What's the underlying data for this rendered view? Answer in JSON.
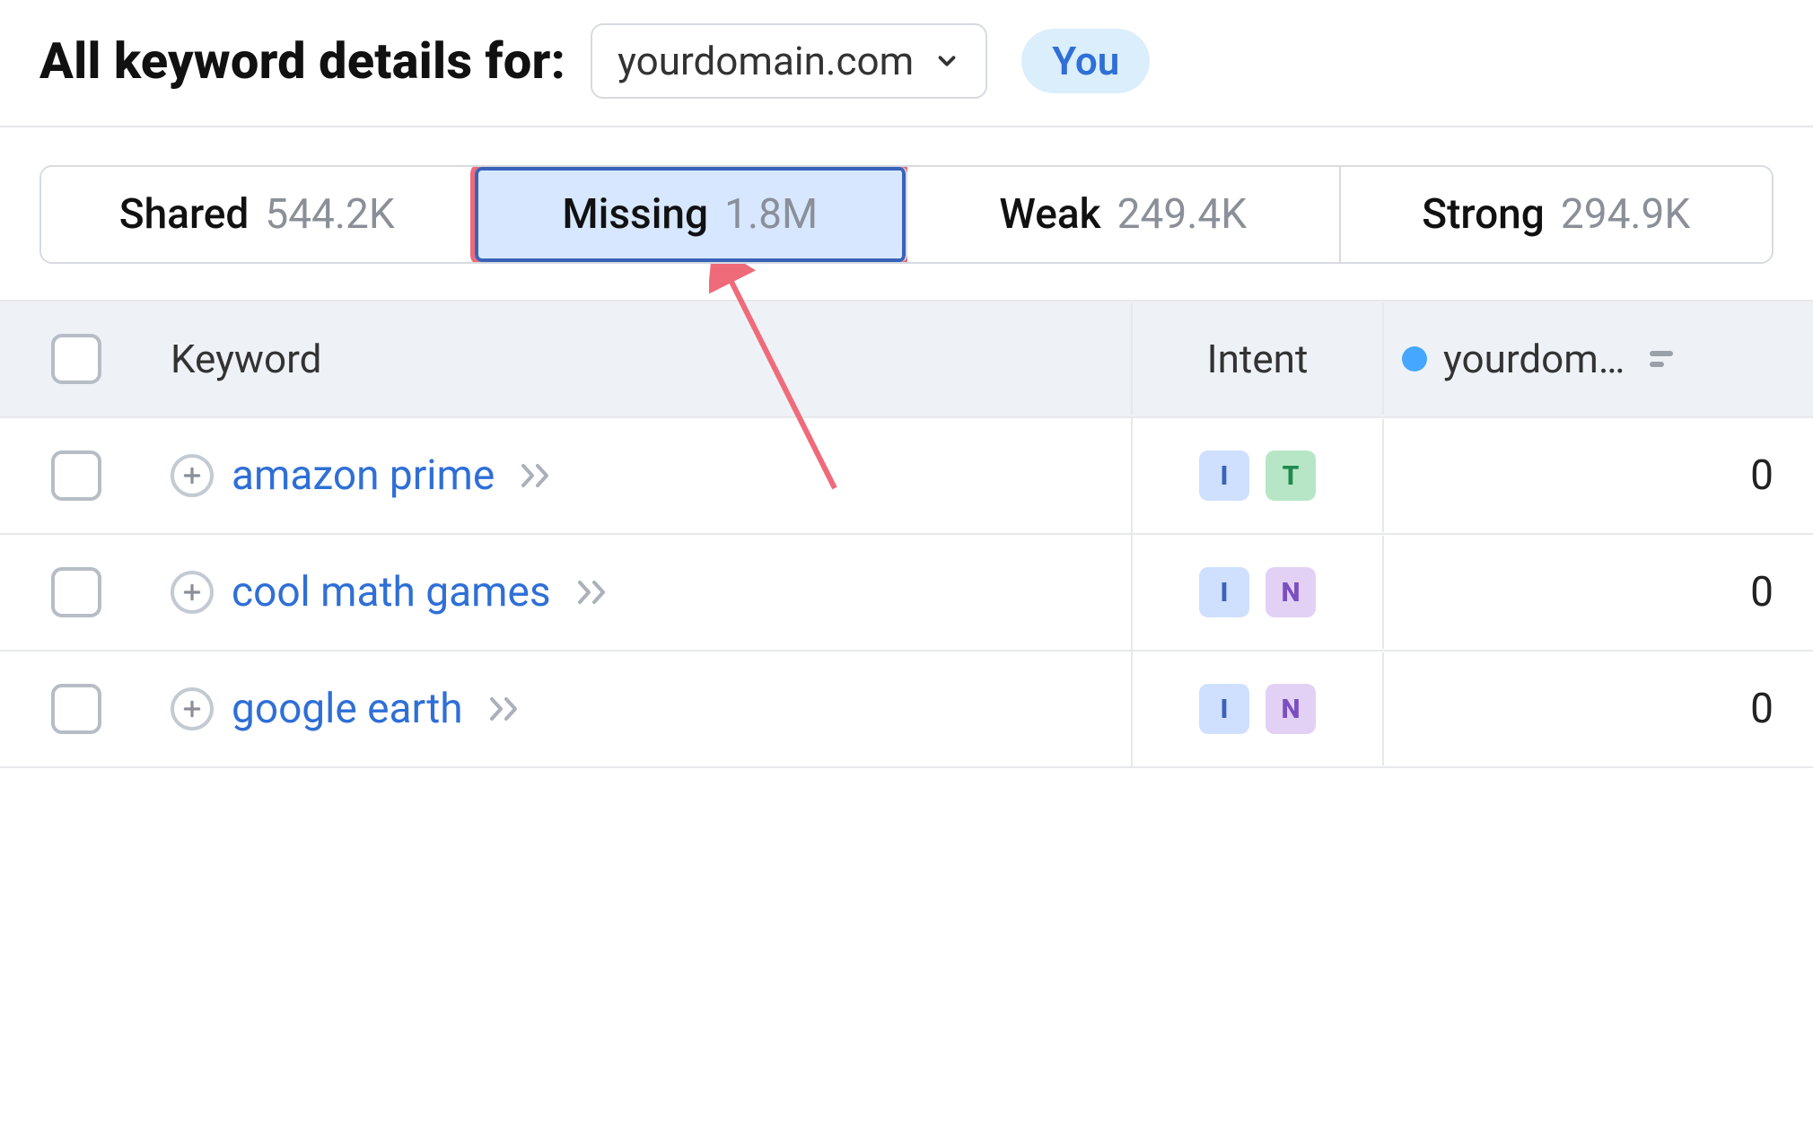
{
  "header": {
    "title": "All keyword details for:",
    "domain": "yourdomain.com",
    "you_badge": "You"
  },
  "tabs": [
    {
      "id": "shared",
      "label": "Shared",
      "count": "544.2K",
      "active": false
    },
    {
      "id": "missing",
      "label": "Missing",
      "count": "1.8M",
      "active": true
    },
    {
      "id": "weak",
      "label": "Weak",
      "count": "249.4K",
      "active": false
    },
    {
      "id": "strong",
      "label": "Strong",
      "count": "294.9K",
      "active": false
    }
  ],
  "columns": {
    "keyword": "Keyword",
    "intent": "Intent",
    "domain": "yourdom…"
  },
  "intent_labels": {
    "I": "I",
    "N": "N",
    "T": "T"
  },
  "rows": [
    {
      "keyword": "amazon prime",
      "intents": [
        "I",
        "T"
      ],
      "value": "0"
    },
    {
      "keyword": "cool math games",
      "intents": [
        "I",
        "N"
      ],
      "value": "0"
    },
    {
      "keyword": "google earth",
      "intents": [
        "I",
        "N"
      ],
      "value": "0"
    }
  ],
  "colors": {
    "highlight_border": "#ef6b7a",
    "highlight_inner": "#3a63b8",
    "link": "#2f6fd6",
    "dot": "#45a7ff"
  }
}
